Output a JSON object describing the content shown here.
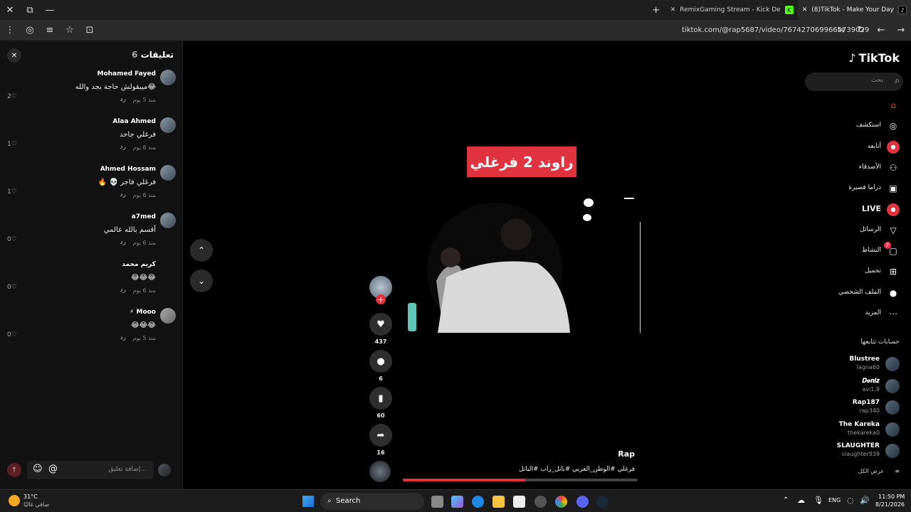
{
  "browser": {
    "tabs": [
      {
        "title": "RemixGaming Stream - Kick De",
        "color": "#53fc18"
      },
      {
        "title": "(8)TikTok - Make Your Day",
        "active": true
      }
    ],
    "url": "tiktok.com/@rap5687/video/7674270699665739029"
  },
  "comments": {
    "title": "تعليقات",
    "count": "6",
    "items": [
      {
        "name": "Mohamed Fayed",
        "text": "😂ميبقولش حاجة بجد والله",
        "time": "منذ 5 يوم",
        "reply": "رد",
        "likes": "2"
      },
      {
        "name": "Alaa Ahmed",
        "text": "فرغلي جاحد",
        "time": "منذ 6 يوم",
        "reply": "رد",
        "likes": "1"
      },
      {
        "name": "Ahmed Hossam",
        "text": "فرغلي فاجر 💀 🔥",
        "time": "منذ 6 يوم",
        "reply": "رد",
        "likes": "1"
      },
      {
        "name": "a7med",
        "text": "أقسم بالله عالمي",
        "time": "منذ 6 يوم",
        "reply": "رد",
        "likes": "0"
      },
      {
        "name": "كريم محمد",
        "text": "😂😂😂",
        "time": "منذ 6 يوم",
        "reply": "رد",
        "likes": "0"
      },
      {
        "name": "Mooo ⚡",
        "text": "😂😂😂",
        "time": "منذ 5 يوم",
        "reply": "رد",
        "likes": "0"
      }
    ],
    "input_placeholder": "...إضافة تعليق"
  },
  "video": {
    "caption": "راوند 2 فرغلي",
    "author": "Rap",
    "description": "فرغلي #الوطن_العربي #باتل_راب #الباتل",
    "progress": 0.52,
    "stats": {
      "likes": "437",
      "comments": "6",
      "saves": "60",
      "shares": "16"
    }
  },
  "sidebar": {
    "logo": "TikTok",
    "search_placeholder": "بحث",
    "nav": [
      {
        "label": "",
        "icon": "home-icon",
        "glyph": "⌂",
        "accent": true
      },
      {
        "label": "استكشف",
        "icon": "compass-icon",
        "glyph": "◎"
      },
      {
        "label": "أتابعه",
        "icon": "following-icon",
        "glyph": "●"
      },
      {
        "label": "الأصدقاء",
        "icon": "friends-icon",
        "glyph": "⚇"
      },
      {
        "label": "دراما قصيرة",
        "icon": "drama-icon",
        "glyph": "▣"
      },
      {
        "label": "LIVE",
        "icon": "live-icon",
        "glyph": "●",
        "bold": true
      },
      {
        "label": "الرسائل",
        "icon": "messages-icon",
        "glyph": "▽"
      },
      {
        "label": "النشاط",
        "icon": "activity-icon",
        "glyph": "▢",
        "badge": "7"
      },
      {
        "label": "تحميل",
        "icon": "upload-icon",
        "glyph": "⊞"
      },
      {
        "label": "الملف الشخصي",
        "icon": "profile-icon",
        "glyph": "●"
      },
      {
        "label": "المزيد",
        "icon": "more-icon",
        "glyph": "⋯"
      }
    ],
    "following_title": "حسابات تتابعها",
    "following": [
      {
        "name": "Blustree",
        "handle": "lagna60"
      },
      {
        "name": "𝑫𝒆𝒏𝒊𝒛",
        "handle": "avi1.9"
      },
      {
        "name": "Rap187",
        "handle": "rap340"
      },
      {
        "name": "The Kareka",
        "handle": "thekareka0"
      },
      {
        "name": "SLAUGHTER",
        "handle": "slaughter939"
      }
    ],
    "see_all": "عرض الكل"
  },
  "taskbar": {
    "weather_temp": "31°C",
    "weather_text": "صافي غالبًا",
    "search_label": "Search",
    "lang": "ENG",
    "time": "11:50 PM",
    "date": "8/21/2026"
  }
}
